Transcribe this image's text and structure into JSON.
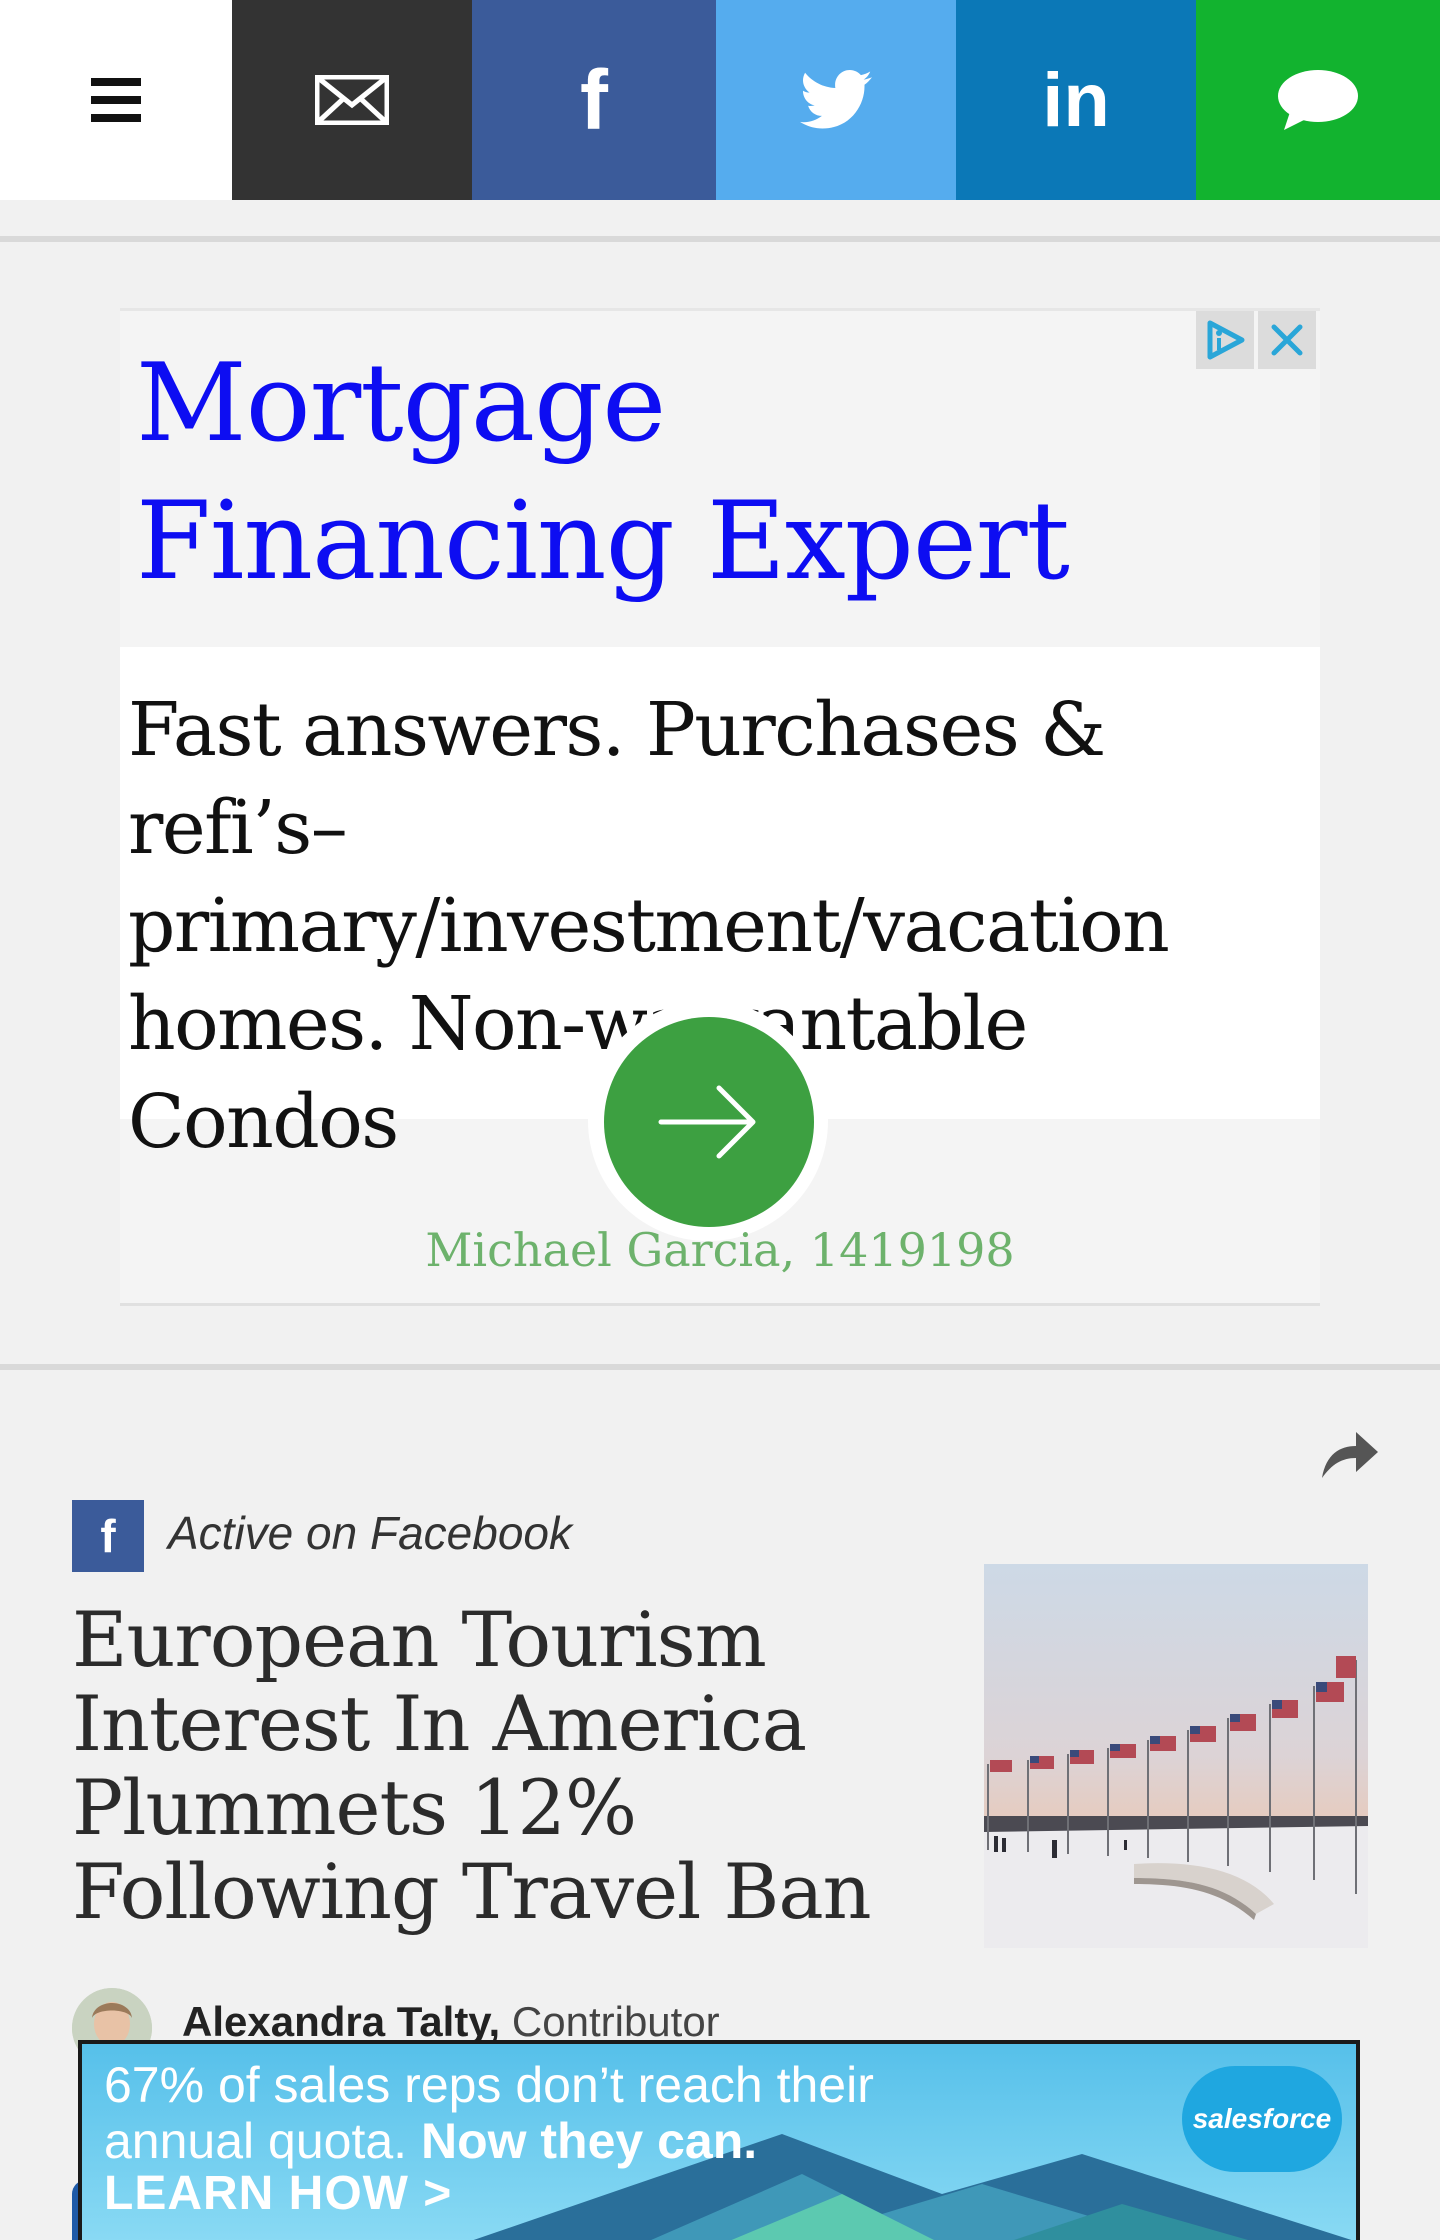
{
  "share_bar": {
    "menu_icon": "hamburger-menu-icon",
    "email_icon": "email-envelope-icon",
    "facebook": {
      "label": "f",
      "color": "#3b5b9a"
    },
    "twitter": {
      "icon": "twitter-bird-icon",
      "color": "#55acee"
    },
    "linkedin": {
      "label": "in",
      "color": "#0b78b7"
    },
    "sms_icon": "chat-bubble-icon",
    "sms_color": "#12b32f"
  },
  "ad": {
    "title": "Mortgage Financing Expert",
    "description": "Fast answers. Purchases & refi’s– primary/investment/vacation homes. Non-warrantable Condos",
    "advertiser": "Michael Garcia, 1419198",
    "title_color": "#0d0df2",
    "button_color": "#3da041",
    "adchoices_icon": "adchoices-icon",
    "close_icon": "close-icon",
    "go_icon": "arrow-right-icon"
  },
  "article": {
    "share_icon": "share-arrow-icon",
    "source_badge": "f",
    "source_label": "Active on Facebook",
    "headline": "European Tourism Interest In America Plummets 12% Following Travel Ban",
    "author_name": "Alexandra Talty,",
    "author_role": "Contributor"
  },
  "banner_ad": {
    "line1": "67% of sales reps don’t reach their",
    "line2_plain": "annual quota.",
    "line2_highlight": "Now they can.",
    "cta": "LEARN HOW >",
    "brand": "salesforce"
  }
}
